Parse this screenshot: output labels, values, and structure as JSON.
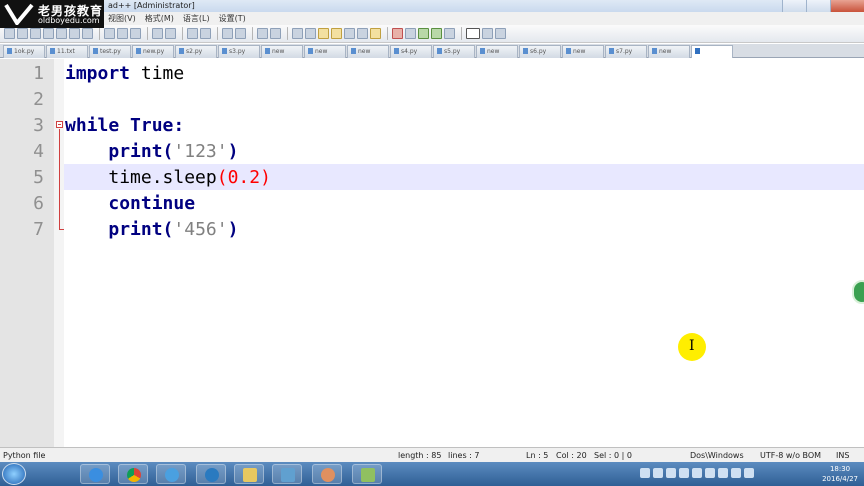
{
  "window": {
    "title": "ad++ [Administrator]"
  },
  "logo": {
    "line1": "老男孩教育",
    "line2": "oldboyedu.com"
  },
  "menu": {
    "items": [
      "视图(V)",
      "格式(M)",
      "语言(L)",
      "设置(T)"
    ]
  },
  "toolbar": {
    "icons": [
      "new-file-icon",
      "open-icon",
      "save-icon",
      "save-all-icon",
      "close-icon",
      "close-all-icon",
      "print-icon",
      "cut-icon",
      "copy-icon",
      "paste-icon",
      "undo-icon",
      "redo-icon",
      "find-icon",
      "replace-icon",
      "zoom-in-icon",
      "zoom-out-icon",
      "sync-v-icon",
      "sync-h-icon",
      "wrap-icon",
      "all-chars-icon",
      "indent-guide-icon",
      "lang-icon",
      "doc-map-icon",
      "func-list-icon",
      "folder-icon",
      "record-icon",
      "stop-icon",
      "play-icon",
      "play-multi-icon",
      "save-macro-icon",
      "spellcheck-icon",
      "misc-icon",
      "misc2-icon"
    ]
  },
  "tabs": [
    {
      "label": "1ok.py"
    },
    {
      "label": "11.txt"
    },
    {
      "label": "test.py"
    },
    {
      "label": "new.py"
    },
    {
      "label": "s2.py"
    },
    {
      "label": "s3.py"
    },
    {
      "label": "new"
    },
    {
      "label": "new"
    },
    {
      "label": "new"
    },
    {
      "label": "s4.py"
    },
    {
      "label": "s5.py"
    },
    {
      "label": "new"
    },
    {
      "label": "s6.py"
    },
    {
      "label": "new"
    },
    {
      "label": "s7.py"
    },
    {
      "label": "new"
    },
    {
      "label": "",
      "active": true
    }
  ],
  "editor": {
    "line_numbers": [
      "1",
      "2",
      "3",
      "4",
      "5",
      "6",
      "7"
    ],
    "line1": {
      "kw": "import",
      "rest": " time"
    },
    "line3": {
      "kw": "while",
      "sp": " ",
      "kw2": "True",
      "colon": ":"
    },
    "line4": {
      "indent": "    ",
      "fn": "print",
      "open": "(",
      "str": "'123'",
      "close": ")"
    },
    "line5": {
      "indent": "    ",
      "obj": "time.sleep",
      "open": "(",
      "num": "0.2",
      "close": ")"
    },
    "line6": {
      "indent": "    ",
      "kw": "continue"
    },
    "line7": {
      "indent": "    ",
      "fn": "print",
      "open": "(",
      "str": "'456'",
      "close": ")"
    }
  },
  "status": {
    "filetype": "Python file",
    "length": "length : 85",
    "lines": "lines : 7",
    "ln": "Ln : 5",
    "col": "Col : 20",
    "sel": "Sel : 0 | 0",
    "eol": "Dos\\Windows",
    "encoding": "UTF-8 w/o BOM",
    "mode": "INS"
  },
  "taskbar": {
    "time": "18:30",
    "date": "2016/4/27"
  },
  "colors": {
    "keyword": "#0000ff",
    "string": "#808080",
    "number": "#ff0000",
    "current_line": "#e8e8ff",
    "gutter": "#e4e4e4"
  }
}
